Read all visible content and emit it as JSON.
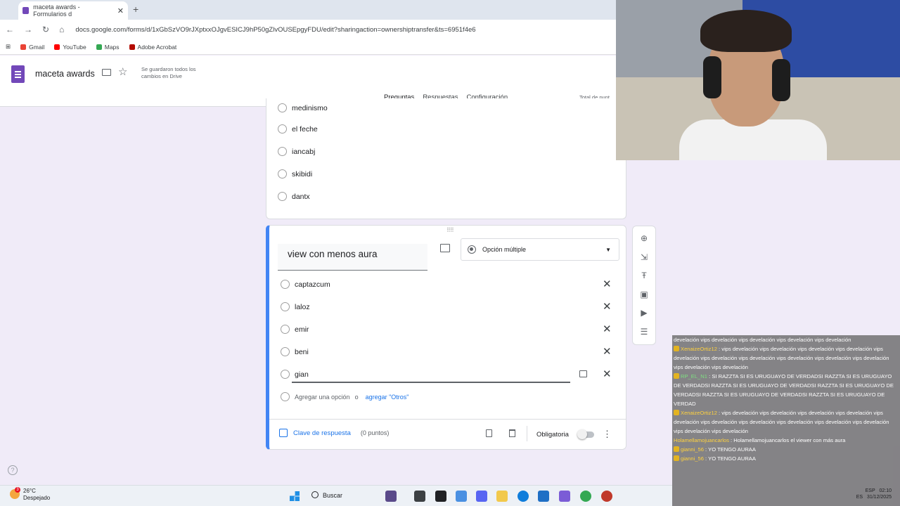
{
  "browser": {
    "tab_title": "maceta awards - Formularios d",
    "url": "docs.google.com/forms/d/1xGbSzVO9rJXptxxOJgvESICJ9hP50gZlvOUSEpgyFDU/edit?sharingaction=ownershiptransfer&ts=6951f4e6",
    "bookmarks": [
      "Gmail",
      "YouTube",
      "Maps",
      "Adobe Acrobat"
    ]
  },
  "form": {
    "title": "maceta awards",
    "saved_status": "Se guardaron todos los cambios en Drive",
    "tabs": [
      "Preguntas",
      "Respuestas",
      "Configuración"
    ],
    "total_points": "Total de punt"
  },
  "prev_question": {
    "options": [
      "medinismo",
      "el feche",
      "iancabj",
      "skibidi",
      "dantx"
    ]
  },
  "question": {
    "title": "view con menos aura",
    "type": "Opción múltiple",
    "options": [
      "captazcum",
      "laloz",
      "emir",
      "beni",
      "gian"
    ],
    "add_option": "Agregar una opción",
    "or": "o",
    "add_other": "agregar \"Otros\"",
    "answer_key": "Clave de respuesta",
    "points": "(0 puntos)",
    "required_label": "Obligatoria"
  },
  "chat": [
    {
      "user": "",
      "text": "develación vips develación vips develación vips develación vips develación"
    },
    {
      "user": "XenaizeOrtiz12",
      "text": "vips develación vips develación vips develación vips develación vips develación vips develación vips develación vips develación vips develación vips develación vips develación vips develación"
    },
    {
      "user": "RP_EL_N1",
      "text": "SI RAZZTA SI ES URUGUAYO DE VERDADSI RAZZTA SI ES URUGUAYO DE VERDADSI RAZZTA SI ES URUGUAYO DE VERDADSI RAZZTA SI ES URUGUAYO DE VERDADSI RAZZTA SI ES URUGUAYO DE VERDADSI RAZZTA SI ES URUGUAYO DE VERDAD"
    },
    {
      "user": "XenaizeOrtiz12",
      "text": "vips develación vips develación vips develación vips develación vips develación vips develación vips develación vips develación vips develación vips develación vips develación vips develación"
    },
    {
      "user": "Holamellamojuancarlos",
      "text": "Holamellamojuancarlos el viewer con más aura"
    },
    {
      "user": "gianni_56",
      "text": "YO TENGO AURAA"
    },
    {
      "user": "gianni_56",
      "text": "YO TENGO AURAA"
    }
  ],
  "taskbar": {
    "temperature": "26°C",
    "weather": "Despejado",
    "weather_badge": "3",
    "search": "Buscar",
    "lang": "ESP",
    "lang2": "ES",
    "time": "02:10",
    "date": "31/12/2025"
  }
}
